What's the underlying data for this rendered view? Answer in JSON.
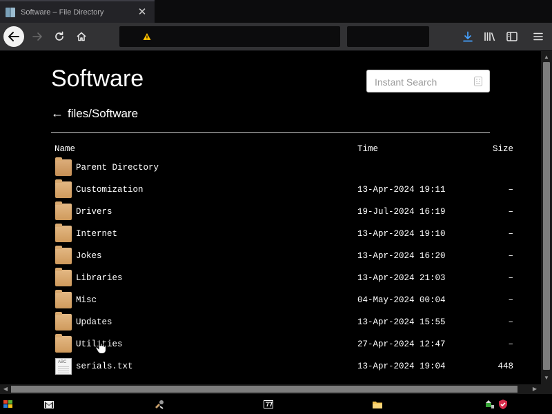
{
  "browser": {
    "tab_title": "Software – File Directory",
    "tab_close": "✕"
  },
  "page": {
    "title": "Software",
    "search_placeholder": "Instant Search",
    "breadcrumb_arrow": "←",
    "breadcrumb_path": "files/Software"
  },
  "listing": {
    "headers": {
      "name": "Name",
      "time": "Time",
      "size": "Size"
    },
    "parent_label": "Parent Directory",
    "rows": [
      {
        "name": "Customization",
        "time": "13-Apr-2024 19:11",
        "size": "–",
        "type": "folder"
      },
      {
        "name": "Drivers",
        "time": "19-Jul-2024 16:19",
        "size": "–",
        "type": "folder"
      },
      {
        "name": "Internet",
        "time": "13-Apr-2024 19:10",
        "size": "–",
        "type": "folder"
      },
      {
        "name": "Jokes",
        "time": "13-Apr-2024 16:20",
        "size": "–",
        "type": "folder"
      },
      {
        "name": "Libraries",
        "time": "13-Apr-2024 21:03",
        "size": "–",
        "type": "folder"
      },
      {
        "name": "Misc",
        "time": "04-May-2024 00:04",
        "size": "–",
        "type": "folder"
      },
      {
        "name": "Updates",
        "time": "13-Apr-2024 15:55",
        "size": "–",
        "type": "folder"
      },
      {
        "name": "Utilities",
        "time": "27-Apr-2024 12:47",
        "size": "–",
        "type": "folder"
      },
      {
        "name": "serials.txt",
        "time": "13-Apr-2024 19:04",
        "size": "448",
        "type": "file"
      }
    ]
  },
  "file_icon_text": "ABC",
  "colors": {
    "background": "#000000",
    "toolbar": "#323234",
    "download_accent": "#45a1ff",
    "folder": "#d9a96f",
    "warning": "#ffbf00"
  },
  "icons": {
    "back": "arrow-left-icon",
    "forward": "arrow-right-icon",
    "reload": "reload-icon",
    "home": "home-icon",
    "download": "download-icon",
    "library": "library-icon",
    "sidebar": "sidebar-icon",
    "menu": "hamburger-menu-icon"
  }
}
